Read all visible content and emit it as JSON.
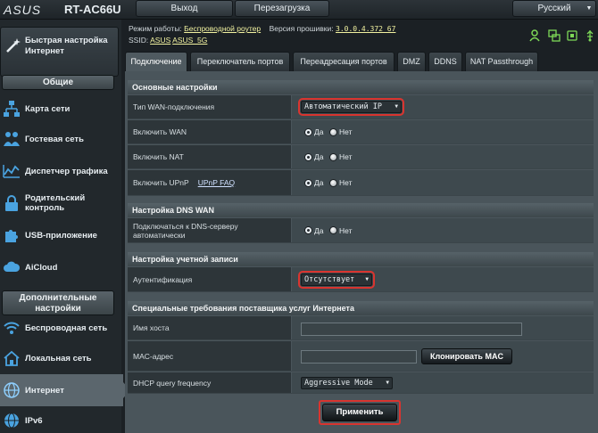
{
  "header": {
    "logo": "ASUS",
    "model": "RT-AC66U",
    "logout_label": "Выход",
    "reboot_label": "Перезагрузка",
    "language_label": "Русский",
    "mode_label": "Режим работы:",
    "mode_value": "Беспроводной роутер",
    "firmware_label": "Версия прошивки:",
    "firmware_value": "3.0.0.4.372_67",
    "ssid_label": "SSID:",
    "ssid_values": [
      "ASUS",
      "ASUS_5G"
    ]
  },
  "sidebar": {
    "quick_setup": "Быстрая настройка Интернет",
    "section_general": "Общие",
    "section_advanced": "Дополнительные настройки",
    "items": [
      {
        "label": "Карта сети",
        "icon": "network-map-icon"
      },
      {
        "label": "Гостевая сеть",
        "icon": "guest-network-icon"
      },
      {
        "label": "Диспетчер трафика",
        "icon": "traffic-manager-icon"
      },
      {
        "label": "Родительский контроль",
        "icon": "lock-icon"
      },
      {
        "label": "USB-приложение",
        "icon": "puzzle-icon"
      },
      {
        "label": "AiCloud",
        "icon": "cloud-icon"
      }
    ],
    "advanced_items": [
      {
        "label": "Беспроводная сеть",
        "icon": "wifi-icon"
      },
      {
        "label": "Локальная сеть",
        "icon": "home-icon"
      },
      {
        "label": "Интернет",
        "icon": "globe-icon",
        "active": true
      },
      {
        "label": "IPv6",
        "icon": "ipv6-globe-icon"
      }
    ]
  },
  "tabs": [
    "Подключение",
    "Переключатель портов",
    "Переадресация портов",
    "DMZ",
    "DDNS",
    "NAT Passthrough"
  ],
  "sections": {
    "basic": {
      "title": "Основные настройки",
      "wan_type_label": "Тип WAN-подключения",
      "wan_type_value": "Автоматический IP",
      "enable_wan_label": "Включить WAN",
      "enable_nat_label": "Включить NAT",
      "enable_upnp_label": "Включить UPnP",
      "upnp_faq": "UPnP FAQ"
    },
    "dns": {
      "title": "Настройка DNS WAN",
      "auto_dns_label": "Подключаться к DNS-серверу автоматически"
    },
    "account": {
      "title": "Настройка учетной записи",
      "auth_label": "Аутентификация",
      "auth_value": "Отсутствует"
    },
    "isp": {
      "title": "Специальные требования поставщика услуг Интернета",
      "hostname_label": "Имя хоста",
      "hostname_value": "",
      "mac_label": "MAC-адрес",
      "mac_value": "",
      "clone_mac_label": "Клонировать MAC",
      "dhcp_label": "DHCP query frequency",
      "dhcp_value": "Aggressive Mode"
    }
  },
  "radio": {
    "yes": "Да",
    "no": "Нет"
  },
  "apply_label": "Применить",
  "colors": {
    "highlight": "#d9342f",
    "panel": "#4a555b",
    "accent_green": "#7ed957"
  }
}
